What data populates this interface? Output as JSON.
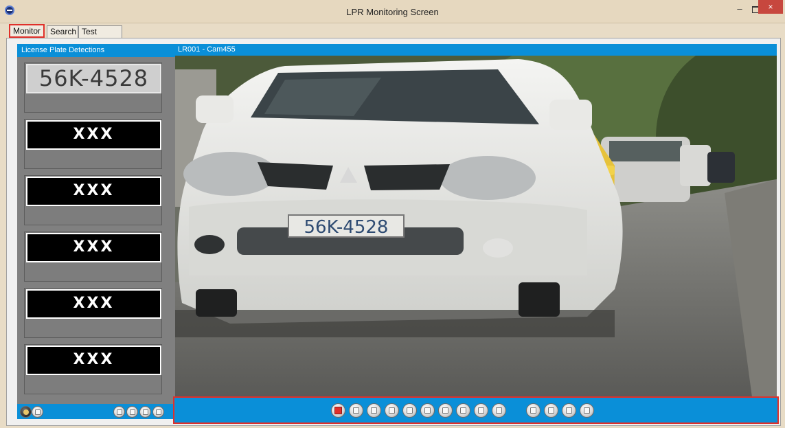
{
  "window": {
    "title": "LPR Monitoring Screen",
    "minimize_glyph": "–",
    "close_glyph": "×"
  },
  "tabs": [
    {
      "label": "Monitor",
      "selected": true
    },
    {
      "label": "Search"
    },
    {
      "label": "Test Alarm"
    }
  ],
  "detections": {
    "header": "License Plate Detections",
    "slots": [
      {
        "plate": "56K-4528"
      },
      {
        "plate": "XXX"
      },
      {
        "plate": "XXX"
      },
      {
        "plate": "XXX"
      },
      {
        "plate": "XXX"
      },
      {
        "plate": "XXX"
      }
    ],
    "toolbar_left_icons": [
      "bell-icon",
      "refresh-icon"
    ],
    "toolbar_right_icons": [
      "prev-page-icon",
      "page-icon",
      "next-page-icon",
      "last-page-icon"
    ]
  },
  "camera": {
    "header": "LR001 - Cam455",
    "feed_plate": "56K-4528",
    "toolbar_icons": [
      "stop-icon",
      "layout-1-icon",
      "layout-4-icon",
      "layout-9-icon",
      "layout-16-icon",
      "layout-25-icon",
      "layout-36-icon",
      "layout-49-icon",
      "layout-64-icon",
      "layout-single-icon",
      "snapshot-icon",
      "record-icon",
      "playback-icon",
      "fullscreen-icon"
    ]
  },
  "colors": {
    "panel_header": "#0a8fd8",
    "highlight_border": "#e0302a",
    "title_bar": "#e6d8bf"
  }
}
